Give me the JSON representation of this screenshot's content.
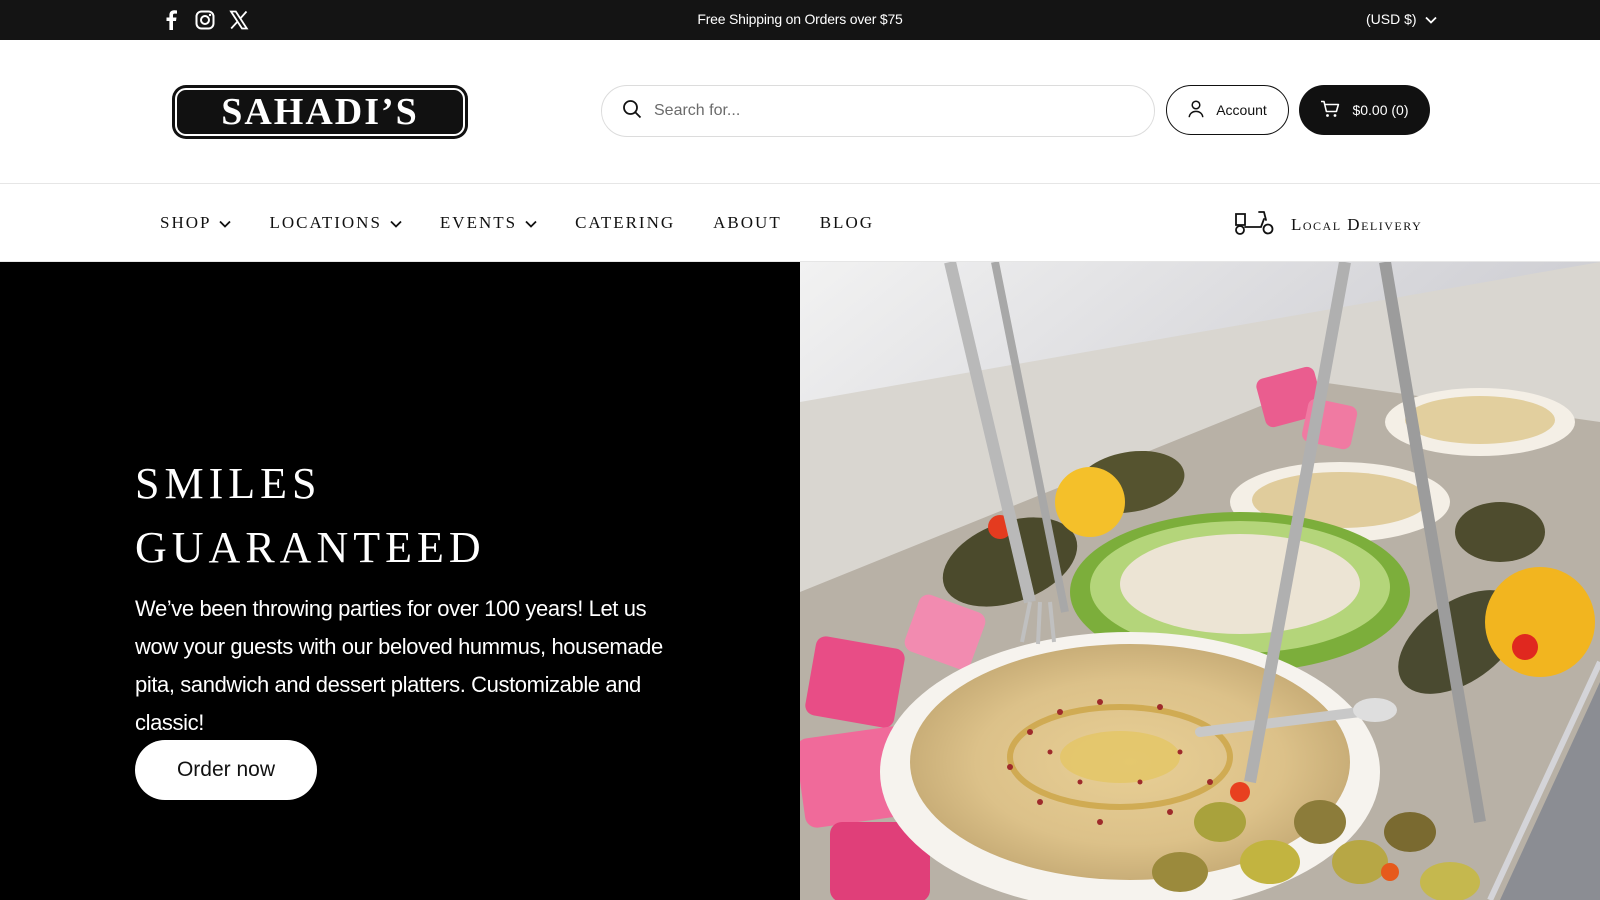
{
  "announcement": {
    "text": "Free Shipping on Orders over $75",
    "social_icons": [
      "facebook-icon",
      "instagram-icon",
      "x-icon"
    ],
    "currency": "(USD $)"
  },
  "header": {
    "logo_text": "SAHADI’S",
    "search": {
      "placeholder": "Search for..."
    },
    "account_label": "Account",
    "cart_label": "$0.00 (0)"
  },
  "nav": {
    "items": [
      {
        "label": "SHOP"
      },
      {
        "label": "LOCATIONS"
      },
      {
        "label": "EVENTS"
      },
      {
        "label": "CATERING"
      },
      {
        "label": "ABOUT"
      },
      {
        "label": "BLOG"
      }
    ],
    "delivery_label": "Local Delivery"
  },
  "hero": {
    "title_line1": "SMILES",
    "title_line2": "GUARANTEED",
    "text": "We’ve been throwing parties for over 100 years! Let us wow your guests with our beloved hummus, housemade pita, sandwich and dessert platters. Customizable and classic!",
    "button_label": "Order now"
  },
  "colors": {
    "topbar": "#141414",
    "hero_bg": "#000000",
    "cart_button": "#111111"
  }
}
